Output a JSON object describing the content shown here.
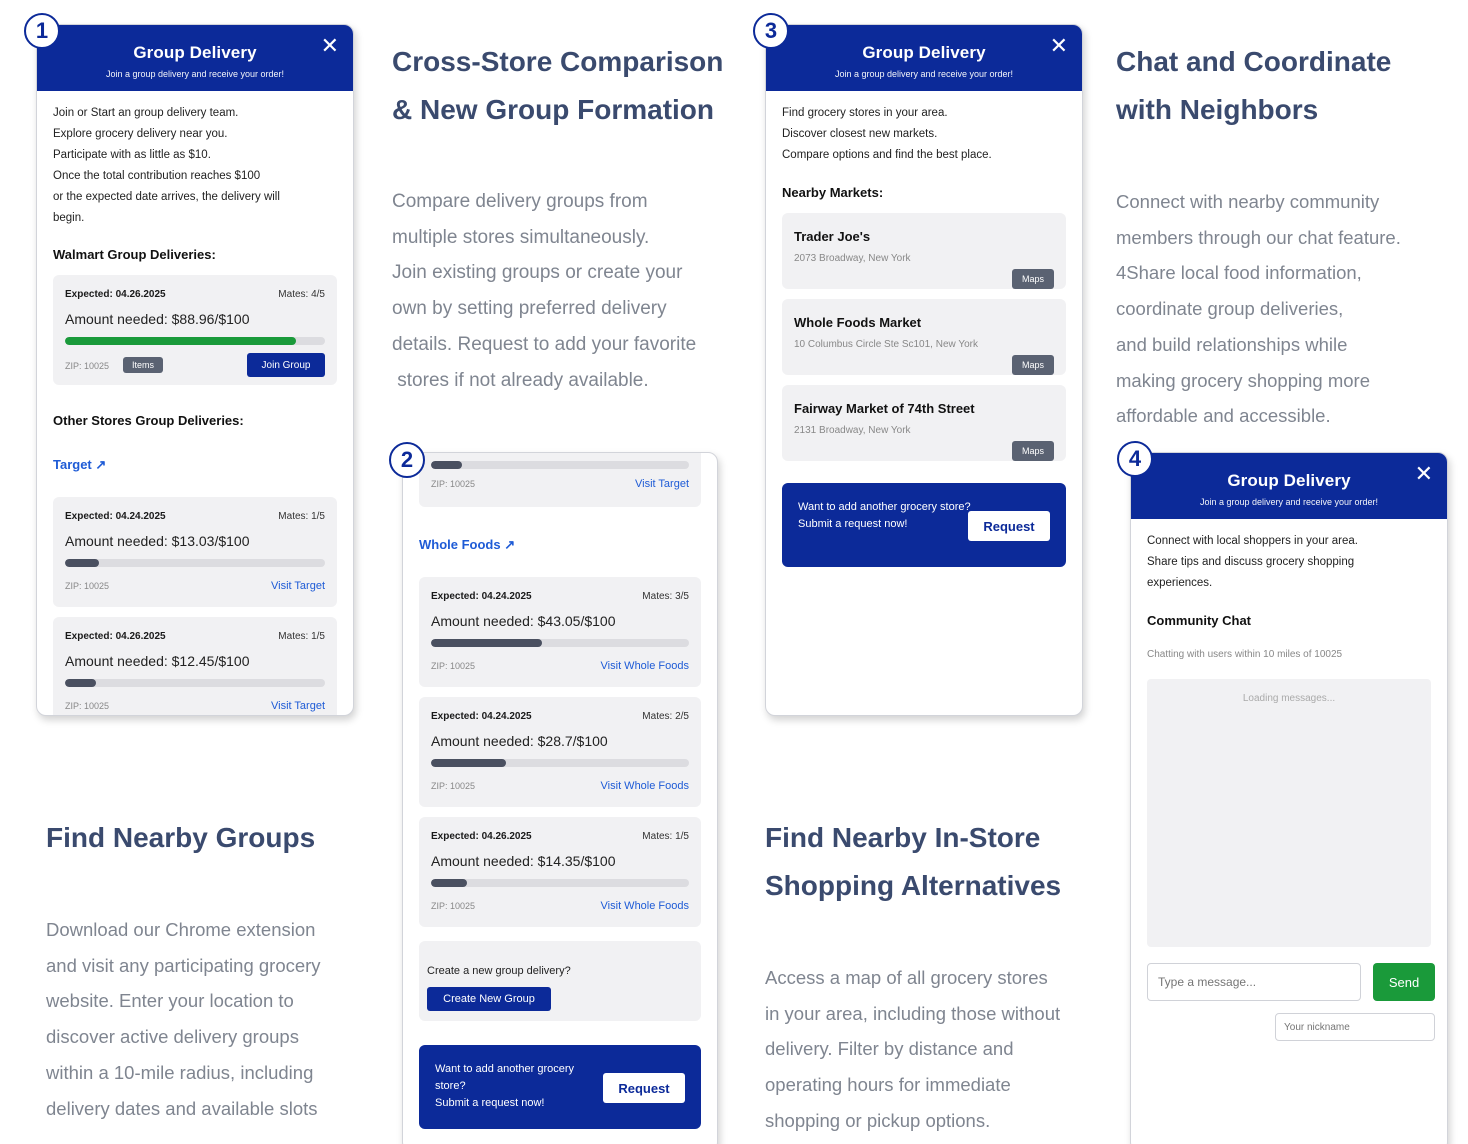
{
  "common": {
    "title": "Group Delivery",
    "subtitle": "Join a group delivery and receive your order!",
    "close": "✕",
    "request_text_1": "Want to add another grocery store?",
    "request_text_2": "Submit a request now!",
    "request_btn": "Request"
  },
  "badges": [
    "1",
    "2",
    "3",
    "4"
  ],
  "p1": {
    "intro": [
      "Join or Start an group delivery team.",
      "Explore grocery delivery near you.",
      "Participate with as little as $10.",
      "Once the total contribution reaches $100",
      "or the expected date arrives, the delivery will",
      "begin."
    ],
    "walmart_title": "Walmart Group Deliveries:",
    "walmart_card": {
      "expected": "Expected: 04.26.2025",
      "mates": "Mates: 4/5",
      "amount": "Amount needed: $88.96/$100",
      "progress": 0.89,
      "zip": "ZIP: 10025",
      "items_label": "Items",
      "join_label": "Join Group"
    },
    "other_title": "Other Stores Group Deliveries:",
    "target_link": "Target ↗",
    "cards": [
      {
        "expected": "Expected: 04.24.2025",
        "mates": "Mates: 1/5",
        "amount": "Amount needed: $13.03/$100",
        "progress": 0.13,
        "zip": "ZIP: 10025",
        "visit": "Visit Target"
      },
      {
        "expected": "Expected: 04.26.2025",
        "mates": "Mates: 1/5",
        "amount": "Amount needed: $12.45/$100",
        "progress": 0.12,
        "zip": "ZIP: 10025",
        "visit": "Visit Target"
      }
    ]
  },
  "p2": {
    "top_card": {
      "progress": 0.12,
      "zip": "ZIP: 10025",
      "visit": "Visit Target"
    },
    "wf_link": "Whole Foods ↗",
    "cards": [
      {
        "expected": "Expected: 04.24.2025",
        "mates": "Mates: 3/5",
        "amount": "Amount needed: $43.05/$100",
        "progress": 0.43,
        "zip": "ZIP: 10025",
        "visit": "Visit Whole Foods"
      },
      {
        "expected": "Expected: 04.24.2025",
        "mates": "Mates: 2/5",
        "amount": "Amount needed: $28.7/$100",
        "progress": 0.29,
        "zip": "ZIP: 10025",
        "visit": "Visit Whole Foods"
      },
      {
        "expected": "Expected: 04.26.2025",
        "mates": "Mates: 1/5",
        "amount": "Amount needed: $14.35/$100",
        "progress": 0.14,
        "zip": "ZIP: 10025",
        "visit": "Visit Whole Foods"
      }
    ],
    "create_text": "Create a new group delivery?",
    "create_btn": "Create New Group"
  },
  "p3": {
    "intro": [
      "Find grocery stores in your area.",
      "Discover closest new markets.",
      "Compare options and find the best place."
    ],
    "nearby_title": "Nearby Markets:",
    "markets": [
      {
        "name": "Trader Joe's",
        "address": "2073 Broadway, New York",
        "maps": "Maps"
      },
      {
        "name": "Whole Foods Market",
        "address": "10 Columbus Circle Ste Sc101, New York",
        "maps": "Maps"
      },
      {
        "name": "Fairway Market of 74th Street",
        "address": "2131 Broadway, New York",
        "maps": "Maps"
      }
    ]
  },
  "p4": {
    "intro": [
      "Connect with local shoppers in your area.",
      "Share tips and discuss grocery shopping",
      "experiences."
    ],
    "chat_title": "Community Chat",
    "chat_sub": "Chatting with users within 10 miles of 10025",
    "loading": "Loading messages...",
    "msg_placeholder": "Type a message...",
    "send": "Send",
    "nick_placeholder": "Your nickname"
  },
  "text": {
    "h_cross": [
      "Cross-Store Comparison",
      "& New Group Formation"
    ],
    "p_cross": [
      "Compare delivery groups from",
      "multiple stores simultaneously.",
      "Join existing groups or create your",
      "own by setting preferred delivery",
      "details. Request to add your favorite",
      " stores if not already available."
    ],
    "h_chat": [
      "Chat and Coordinate",
      "with Neighbors"
    ],
    "p_chat": [
      "Connect with nearby community",
      "members through our chat feature.",
      "4Share local food information,",
      "coordinate group deliveries,",
      "and build relationships while",
      "making grocery shopping more",
      "affordable and accessible."
    ],
    "h_find": [
      "Find Nearby Groups"
    ],
    "p_find": [
      "Download our Chrome extension",
      "and visit any participating grocery",
      "website. Enter your location to",
      "discover active delivery groups",
      "within a 10-mile radius, including",
      "delivery dates and available slots"
    ],
    "h_instore": [
      "Find Nearby In-Store",
      "Shopping Alternatives"
    ],
    "p_instore": [
      "Access a map of all grocery stores",
      "in your area, including those without",
      "delivery. Filter by distance and",
      "operating hours for immediate",
      "shopping or pickup options."
    ]
  }
}
